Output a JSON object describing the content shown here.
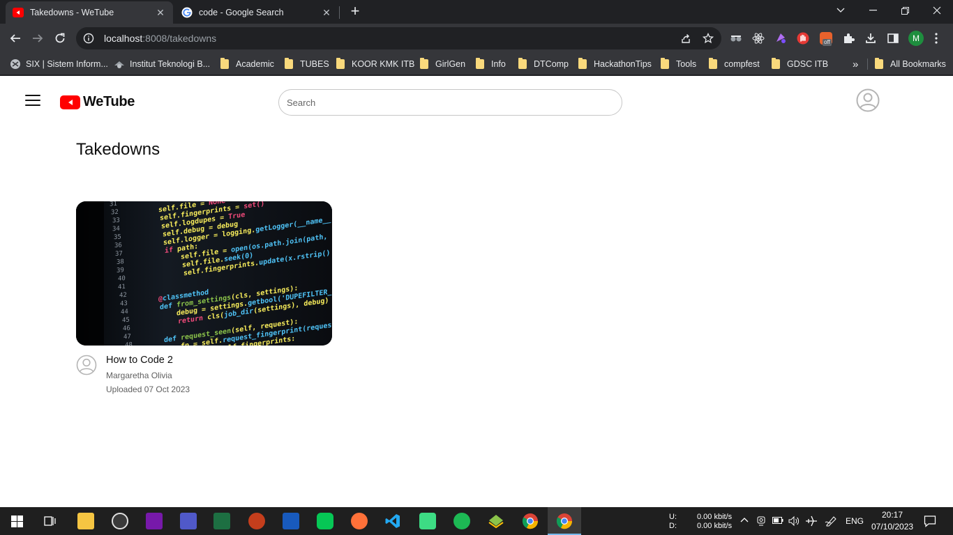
{
  "browser": {
    "tabs": [
      {
        "title": "Takedowns - WeTube",
        "active": true
      },
      {
        "title": "code - Google Search",
        "active": false
      }
    ],
    "url_host": "localhost",
    "url_rest": ":8008/takedowns",
    "bookmarks": [
      {
        "label": "SIX | Sistem Inform...",
        "type": "site"
      },
      {
        "label": "Institut Teknologi B...",
        "type": "site"
      },
      {
        "label": "Academic",
        "type": "folder"
      },
      {
        "label": "TUBES",
        "type": "folder"
      },
      {
        "label": "KOOR KMK ITB",
        "type": "folder"
      },
      {
        "label": "GirlGen",
        "type": "folder"
      },
      {
        "label": "Info",
        "type": "folder"
      },
      {
        "label": "DTComp",
        "type": "folder"
      },
      {
        "label": "HackathonTips",
        "type": "folder"
      },
      {
        "label": "Tools",
        "type": "folder"
      },
      {
        "label": "compfest",
        "type": "folder"
      },
      {
        "label": "GDSC ITB",
        "type": "folder"
      }
    ],
    "bookmarks_overflow": "»",
    "all_bookmarks": "All Bookmarks",
    "profile_initial": "M",
    "extension_badge": "off"
  },
  "app": {
    "logo_text": "WeTube",
    "search_placeholder": "Search",
    "page_title": "Takedowns",
    "videos": [
      {
        "title": "How to Code 2",
        "author": "Margaretha Olivia",
        "uploaded": "Uploaded 07 Oct 2023"
      }
    ]
  },
  "taskbar": {
    "net_up_label": "U:",
    "net_down_label": "D:",
    "net_up": "0.00 kbit/s",
    "net_down": "0.00 kbit/s",
    "language": "ENG",
    "time": "20:17",
    "date": "07/10/2023"
  },
  "colors": {
    "brand_red": "#ff0000",
    "chrome_dark": "#202124",
    "chrome_toolbar": "#35363a",
    "taskbar": "#1f1f1f"
  }
}
